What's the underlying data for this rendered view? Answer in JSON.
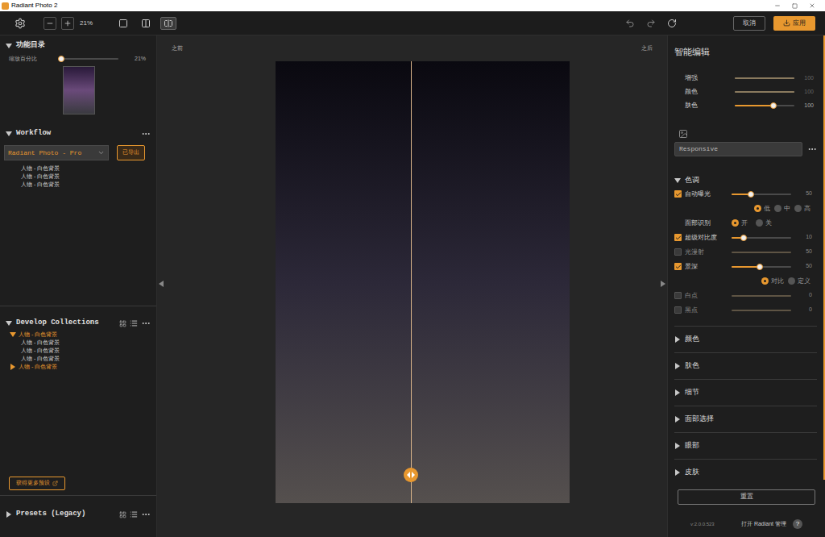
{
  "window": {
    "title": "Radiant Photo 2"
  },
  "toolbar": {
    "zoom": "21%",
    "view_modes": [
      {
        "selected": false
      },
      {
        "selected": false
      },
      {
        "selected": true
      }
    ],
    "cancel": "取消",
    "apply": "应用"
  },
  "left_panel": {
    "catalog": {
      "title": "功能目录",
      "expanded": true,
      "zoom_label": "缩放百分比",
      "zoom_value": "21%",
      "zoom_level": 0.04
    },
    "workflow": {
      "title": "Workflow",
      "expanded": true,
      "dropdown": "Radiant Photo - Pro",
      "button": "已导出",
      "items": [
        "人物 - 白色背景",
        "人物 - 白色背景",
        "人物 - 白色背景"
      ]
    },
    "develop_collections": {
      "title": "Develop Collections",
      "expanded": true,
      "groups": [
        {
          "label": "人物 - 白色背景",
          "expanded": true,
          "children": [
            "人物 - 白色背景",
            "人物 - 白色背景",
            "人物 - 白色背景"
          ]
        },
        {
          "label": "人物 - 白色背景",
          "expanded": false,
          "children": []
        }
      ]
    },
    "more_presets_button": "获得更多预设",
    "presets": {
      "title": "Presets (Legacy)",
      "expanded": false
    }
  },
  "canvas": {
    "before_label": "之前",
    "after_label": "之后",
    "split": 0.46
  },
  "right_panel": {
    "title": "智能编辑",
    "smart_sliders": [
      {
        "label": "增强",
        "value": "100",
        "level": 1,
        "enabled": false
      },
      {
        "label": "颜色",
        "value": "100",
        "level": 1,
        "enabled": false
      },
      {
        "label": "肤色",
        "value": "100",
        "level": 0.65,
        "enabled": true
      }
    ],
    "preset_dropdown": "Responsive",
    "sections": [
      {
        "title": "色调",
        "expanded": true,
        "rows": [
          {
            "kind": "slider",
            "label": "自动曝光",
            "checked": true,
            "value": "50",
            "level": 0.32
          },
          {
            "kind": "radio",
            "label": "",
            "options": [
              {
                "label": "低",
                "selected": true
              },
              {
                "label": "中",
                "selected": false
              },
              {
                "label": "高",
                "selected": false
              }
            ]
          },
          {
            "kind": "radio",
            "label": "面部识别",
            "options": [
              {
                "label": "开",
                "selected": true
              },
              {
                "label": "关",
                "selected": false
              }
            ]
          },
          {
            "kind": "slider",
            "label": "超级对比度",
            "checked": true,
            "value": "10",
            "level": 0.2
          },
          {
            "kind": "slider",
            "label": "光漫射",
            "checked": false,
            "value": "50"
          },
          {
            "kind": "slider",
            "label": "景深",
            "checked": true,
            "value": "50",
            "level": 0.47
          },
          {
            "kind": "radio",
            "label": "",
            "options": [
              {
                "label": "对比",
                "selected": true
              },
              {
                "label": "定义",
                "selected": false
              }
            ]
          },
          {
            "kind": "slider",
            "label": "白点",
            "checked": false,
            "value": "0"
          },
          {
            "kind": "slider",
            "label": "黑点",
            "checked": false,
            "value": "0"
          }
        ]
      },
      {
        "title": "颜色",
        "expanded": false,
        "rows": []
      },
      {
        "title": "肤色",
        "expanded": false,
        "rows": []
      },
      {
        "title": "细节",
        "expanded": false,
        "rows": []
      },
      {
        "title": "面部选择",
        "expanded": false,
        "rows": []
      },
      {
        "title": "眼部",
        "expanded": false,
        "rows": []
      },
      {
        "title": "皮肤",
        "expanded": false,
        "rows": []
      }
    ],
    "reset_button": "重置"
  },
  "footer": {
    "version": "v:2.0.0.523",
    "manage_link": "打开 Radiant 管理",
    "help": "?"
  }
}
